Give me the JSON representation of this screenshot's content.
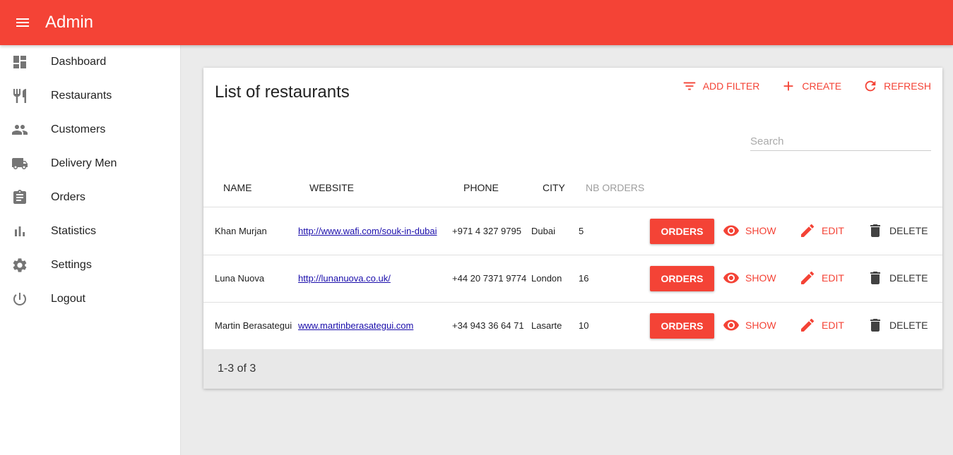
{
  "app": {
    "title": "Admin"
  },
  "sidebar": {
    "items": [
      {
        "label": "Dashboard",
        "icon": "dashboard-icon"
      },
      {
        "label": "Restaurants",
        "icon": "restaurant-icon"
      },
      {
        "label": "Customers",
        "icon": "people-icon"
      },
      {
        "label": "Delivery Men",
        "icon": "truck-icon"
      },
      {
        "label": "Orders",
        "icon": "clipboard-icon"
      },
      {
        "label": "Statistics",
        "icon": "bar-chart-icon"
      },
      {
        "label": "Settings",
        "icon": "gear-icon"
      },
      {
        "label": "Logout",
        "icon": "power-icon"
      }
    ]
  },
  "list": {
    "title": "List of restaurants",
    "actions": {
      "add_filter": "Add filter",
      "create": "Create",
      "refresh": "Refresh"
    },
    "search_placeholder": "Search",
    "columns": {
      "name": "Name",
      "website": "Website",
      "phone": "Phone",
      "city": "City",
      "nb_orders": "NB Orders"
    },
    "rows": [
      {
        "name": "Khan Murjan",
        "website": "http://www.wafi.com/souk-in-dubai",
        "phone": "+971 4 327 9795",
        "city": "Dubai",
        "nb_orders": "5"
      },
      {
        "name": "Luna Nuova",
        "website": "http://lunanuova.co.uk/",
        "phone": "+44 20 7371 9774",
        "city": "London",
        "nb_orders": "16"
      },
      {
        "name": "Martin Berasategui",
        "website": "www.martinberasategui.com",
        "phone": "+34 943 36 64 71",
        "city": "Lasarte",
        "nb_orders": "10"
      }
    ],
    "row_actions": {
      "orders": "Orders",
      "show": "Show",
      "edit": "Edit",
      "delete": "Delete"
    },
    "pagination": "1-3 of 3"
  },
  "colors": {
    "accent": "#f44336",
    "background": "#ebebeb"
  }
}
